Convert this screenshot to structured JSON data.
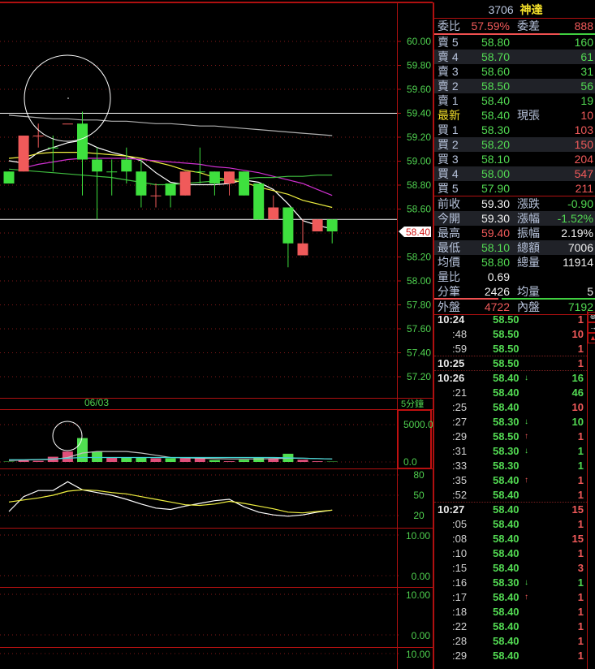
{
  "stock": {
    "code": "3706",
    "name": "神達"
  },
  "colors": {
    "up": "#f05a5a",
    "down": "#3ee03e",
    "grid": "#b01010",
    "axis_text": "#4fd04f"
  },
  "chart": {
    "price_axis": [
      "60.00",
      "59.80",
      "59.60",
      "59.40",
      "59.20",
      "59.00",
      "58.80",
      "58.60",
      "58.20",
      "58.00",
      "57.80",
      "57.60",
      "57.40",
      "57.20"
    ],
    "price_axis_values": [
      60.0,
      59.8,
      59.6,
      59.4,
      59.2,
      59.0,
      58.8,
      58.6,
      58.2,
      58.0,
      57.8,
      57.6,
      57.4,
      57.2
    ],
    "last_price_badge": "58.40",
    "last_price": 58.4,
    "ref_line": 58.5,
    "high_line": 59.4,
    "date_label": "06/03",
    "period_label": "5分鐘",
    "candles": [
      [
        58.9,
        58.9,
        58.8,
        58.8
      ],
      [
        58.9,
        59.2,
        58.9,
        59.2
      ],
      [
        59.2,
        59.3,
        59.1,
        59.2
      ],
      [
        59.1,
        59.2,
        58.9,
        59.1
      ],
      [
        59.3,
        59.3,
        59.3,
        59.3
      ],
      [
        59.3,
        59.4,
        58.7,
        59.0
      ],
      [
        59.0,
        59.1,
        58.5,
        58.9
      ],
      [
        58.9,
        59.0,
        58.7,
        58.9
      ],
      [
        59.0,
        59.1,
        58.8,
        58.9
      ],
      [
        58.9,
        59.0,
        58.6,
        58.7
      ],
      [
        58.7,
        58.8,
        58.6,
        58.7
      ],
      [
        58.8,
        58.8,
        58.6,
        58.7
      ],
      [
        58.7,
        58.9,
        58.7,
        58.9
      ],
      [
        58.9,
        59.1,
        58.8,
        58.9
      ],
      [
        58.9,
        58.9,
        58.7,
        58.8
      ],
      [
        58.8,
        58.9,
        58.7,
        58.9
      ],
      [
        58.9,
        58.9,
        58.7,
        58.7
      ],
      [
        58.8,
        58.8,
        58.5,
        58.5
      ],
      [
        58.5,
        58.7,
        58.5,
        58.6
      ],
      [
        58.6,
        58.6,
        58.1,
        58.3
      ],
      [
        58.2,
        58.5,
        58.2,
        58.3
      ],
      [
        58.4,
        58.5,
        58.4,
        58.5
      ],
      [
        58.5,
        58.5,
        58.3,
        58.4
      ]
    ],
    "ma_series": [
      {
        "name": "ma-white",
        "color": "#ffffff",
        "values": [
          58.99,
          58.97,
          59.06,
          59.1,
          59.14,
          59.16,
          59.1,
          59.06,
          59.03,
          58.99,
          58.89,
          58.81,
          58.79,
          58.79,
          58.79,
          58.8,
          58.83,
          58.81,
          58.75,
          58.63,
          58.49,
          58.45,
          58.42
        ]
      },
      {
        "name": "ma-yellow",
        "color": "#f0f040",
        "values": [
          59.01,
          59.02,
          59.05,
          59.06,
          59.06,
          59.06,
          59.05,
          59.04,
          59.03,
          59.01,
          58.98,
          58.95,
          58.91,
          58.89,
          58.85,
          58.83,
          58.81,
          58.77,
          58.74,
          58.71,
          58.66,
          58.63,
          58.6
        ]
      },
      {
        "name": "ma-magenta",
        "color": "#d030d0",
        "values": [
          null,
          58.93,
          58.96,
          58.98,
          59.0,
          59.01,
          59.01,
          59.01,
          59.01,
          59.0,
          58.99,
          58.98,
          58.97,
          58.96,
          58.94,
          58.93,
          58.91,
          58.89,
          58.86,
          58.83,
          58.8,
          58.75,
          58.7
        ]
      },
      {
        "name": "ma-green",
        "color": "#40c040",
        "values": [
          58.92,
          58.91,
          58.9,
          58.89,
          58.88,
          58.87,
          58.86,
          58.85,
          58.83,
          58.81,
          58.79,
          58.79,
          58.8,
          58.81,
          58.82,
          58.83,
          58.84,
          58.85,
          58.85,
          58.86,
          58.86,
          58.87,
          58.87
        ]
      },
      {
        "name": "ma-gray",
        "color": "#b0b0b0",
        "values": [
          59.37,
          59.36,
          59.35,
          59.34,
          59.34,
          59.33,
          59.33,
          59.32,
          59.32,
          59.31,
          59.3,
          59.3,
          59.29,
          59.28,
          59.28,
          59.27,
          59.26,
          59.25,
          59.24,
          59.23,
          59.22,
          59.21,
          59.2
        ]
      }
    ],
    "volume_axis": [
      "5000.0",
      "0.0"
    ],
    "volumes": [
      50,
      300,
      150,
      700,
      1400,
      3200,
      1400,
      600,
      600,
      600,
      500,
      500,
      500,
      500,
      250,
      100,
      300,
      600,
      500,
      1100,
      300,
      100,
      50
    ],
    "volume_ma": [
      {
        "name": "vol-ma-gray",
        "color": "#c0c0c0",
        "values": [
          200,
          250,
          300,
          350,
          600,
          1200,
          1400,
          1400,
          1400,
          1200,
          900,
          600,
          550,
          500,
          450,
          400,
          400,
          400,
          450,
          500,
          500,
          450,
          400
        ]
      },
      {
        "name": "vol-ma-cyan",
        "color": "#40d0d0",
        "values": [
          300,
          300,
          350,
          400,
          500,
          600,
          600,
          600,
          600,
          600,
          600,
          600,
          600,
          600,
          600,
          600,
          600,
          600,
          600,
          550,
          500,
          450,
          400
        ]
      }
    ],
    "osc_axis": [
      "80",
      "50",
      "20"
    ],
    "osc_axis_values": [
      80,
      50,
      20
    ],
    "osc_series": [
      {
        "name": "osc-white",
        "color": "#ffffff",
        "values": [
          26,
          48,
          57,
          57,
          70,
          58,
          54,
          50,
          44,
          37,
          31,
          29,
          34,
          38,
          42,
          44,
          33,
          25,
          21,
          19,
          21,
          25,
          28
        ]
      },
      {
        "name": "osc-yellow",
        "color": "#f0f040",
        "values": [
          40,
          43,
          46,
          50,
          56,
          58,
          57,
          54,
          52,
          48,
          44,
          40,
          36,
          35,
          37,
          41,
          38,
          34,
          30,
          25,
          24,
          26,
          28
        ]
      }
    ],
    "panel3_axis": [
      "10.00",
      "0.00"
    ],
    "panel4_axis": [
      "10.00",
      "0.00"
    ],
    "panel5_axis": [
      "10.00"
    ]
  },
  "quote": {
    "ratio": {
      "label": "委比",
      "value": "57.59%",
      "label2": "委差",
      "value2": "888"
    },
    "asks": [
      {
        "label": "賣 5",
        "price": "58.80",
        "vol": "160"
      },
      {
        "label": "賣 4",
        "price": "58.70",
        "vol": "61"
      },
      {
        "label": "賣 3",
        "price": "58.60",
        "vol": "31"
      },
      {
        "label": "賣 2",
        "price": "58.50",
        "vol": "56"
      },
      {
        "label": "賣 1",
        "price": "58.40",
        "vol": "19"
      }
    ],
    "last": {
      "label": "最新",
      "price": "58.40",
      "label2": "現張",
      "vol": "10"
    },
    "bids": [
      {
        "label": "買 1",
        "price": "58.30",
        "vol": "103"
      },
      {
        "label": "買 2",
        "price": "58.20",
        "vol": "150"
      },
      {
        "label": "買 3",
        "price": "58.10",
        "vol": "204"
      },
      {
        "label": "買 4",
        "price": "58.00",
        "vol": "547"
      },
      {
        "label": "買 5",
        "price": "57.90",
        "vol": "211"
      }
    ],
    "stats": [
      {
        "label": "前收",
        "value": "59.30",
        "vc": "w",
        "label2": "漲跌",
        "value2": "-0.90",
        "vc2": "g"
      },
      {
        "label": "今開",
        "value": "59.30",
        "vc": "w",
        "label2": "漲幅",
        "value2": "-1.52%",
        "vc2": "g"
      },
      {
        "label": "最高",
        "value": "59.40",
        "vc": "r",
        "label2": "振幅",
        "value2": "2.19%",
        "vc2": "w"
      },
      {
        "label": "最低",
        "value": "58.10",
        "vc": "g",
        "label2": "總額",
        "value2": "7006",
        "vc2": "w"
      },
      {
        "label": "均價",
        "value": "58.80",
        "vc": "g",
        "label2": "總量",
        "value2": "11914",
        "vc2": "w"
      },
      {
        "label": "量比",
        "value": "0.69",
        "vc": "w",
        "label2": "",
        "value2": "",
        "vc2": "w"
      },
      {
        "label": "分筆",
        "value": "2426",
        "vc": "w",
        "label2": "均量",
        "value2": "5",
        "vc2": "w"
      }
    ],
    "outer": {
      "label": "外盤",
      "value": "4722",
      "label2": "內盤",
      "value2": "7192"
    }
  },
  "ticks": [
    {
      "time": "10:24",
      "main": true,
      "price": "58.50",
      "arrow": "",
      "vol": "1",
      "vc": "r"
    },
    {
      "time": ":48",
      "price": "58.50",
      "arrow": "",
      "vol": "10",
      "vc": "r"
    },
    {
      "time": ":59",
      "price": "58.50",
      "arrow": "",
      "vol": "1",
      "vc": "r",
      "sep": true
    },
    {
      "time": "10:25",
      "main": true,
      "price": "58.50",
      "arrow": "",
      "vol": "1",
      "vc": "r",
      "sep": true
    },
    {
      "time": "10:26",
      "main": true,
      "price": "58.40",
      "arrow": "↓",
      "vol": "16",
      "vc": "g"
    },
    {
      "time": ":21",
      "price": "58.40",
      "arrow": "",
      "vol": "46",
      "vc": "g"
    },
    {
      "time": ":25",
      "price": "58.40",
      "arrow": "",
      "vol": "10",
      "vc": "r"
    },
    {
      "time": ":27",
      "price": "58.30",
      "arrow": "↓",
      "vol": "10",
      "vc": "g"
    },
    {
      "time": ":29",
      "price": "58.50",
      "arrow": "↑",
      "vol": "1",
      "vc": "r"
    },
    {
      "time": ":31",
      "price": "58.30",
      "arrow": "↓",
      "vol": "1",
      "vc": "g"
    },
    {
      "time": ":33",
      "price": "58.30",
      "arrow": "",
      "vol": "1",
      "vc": "g"
    },
    {
      "time": ":35",
      "price": "58.40",
      "arrow": "↑",
      "vol": "1",
      "vc": "r"
    },
    {
      "time": ":52",
      "price": "58.40",
      "arrow": "",
      "vol": "1",
      "vc": "r",
      "sep": true
    },
    {
      "time": "10:27",
      "main": true,
      "price": "58.40",
      "arrow": "",
      "vol": "15",
      "vc": "r"
    },
    {
      "time": ":05",
      "price": "58.40",
      "arrow": "",
      "vol": "1",
      "vc": "r"
    },
    {
      "time": ":08",
      "price": "58.40",
      "arrow": "",
      "vol": "15",
      "vc": "r"
    },
    {
      "time": ":10",
      "price": "58.40",
      "arrow": "",
      "vol": "1",
      "vc": "r"
    },
    {
      "time": ":15",
      "price": "58.40",
      "arrow": "",
      "vol": "3",
      "vc": "r"
    },
    {
      "time": ":16",
      "price": "58.30",
      "arrow": "↓",
      "vol": "1",
      "vc": "g"
    },
    {
      "time": ":17",
      "price": "58.40",
      "arrow": "↑",
      "vol": "1",
      "vc": "r"
    },
    {
      "time": ":18",
      "price": "58.40",
      "arrow": "",
      "vol": "1",
      "vc": "r"
    },
    {
      "time": ":22",
      "price": "58.40",
      "arrow": "",
      "vol": "1",
      "vc": "r"
    },
    {
      "time": ":28",
      "price": "58.40",
      "arrow": "",
      "vol": "1",
      "vc": "r"
    },
    {
      "time": ":29",
      "price": "58.40",
      "arrow": "",
      "vol": "1",
      "vc": "r"
    }
  ]
}
